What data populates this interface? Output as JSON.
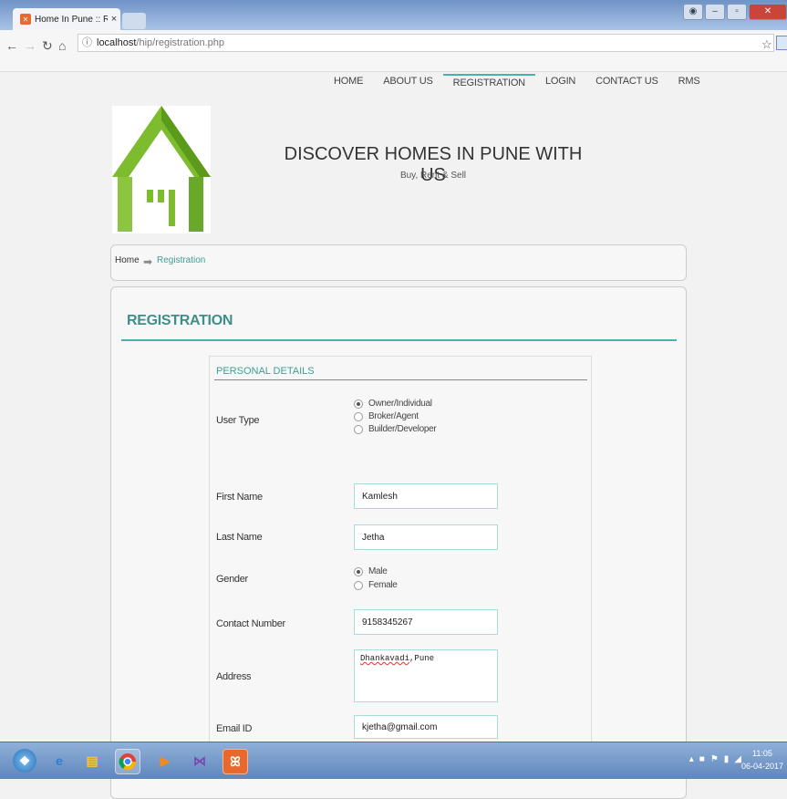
{
  "browser": {
    "tab_title": "Home In Pune :: Registra",
    "url_host": "localhost",
    "url_path": "/hip/registration.php"
  },
  "nav": {
    "items": [
      {
        "label": "HOME",
        "active": false
      },
      {
        "label": "ABOUT US",
        "active": false
      },
      {
        "label": "REGISTRATION",
        "active": true
      },
      {
        "label": "LOGIN",
        "active": false
      },
      {
        "label": "CONTACT US",
        "active": false
      },
      {
        "label": "RMS",
        "active": false
      }
    ]
  },
  "header": {
    "headline": "DISCOVER HOMES IN PUNE WITH US",
    "tagline": "Buy, Rent & Sell"
  },
  "breadcrumb": {
    "home": "Home",
    "current": "Registration"
  },
  "form": {
    "title": "REGISTRATION",
    "section": "PERSONAL DETAILS",
    "user_type_label": "User Type",
    "user_types": [
      "Owner/Individual",
      "Broker/Agent",
      "Builder/Developer"
    ],
    "user_type_selected": "Owner/Individual",
    "first_name_label": "First Name",
    "first_name": "Kamlesh",
    "last_name_label": "Last Name",
    "last_name": "Jetha",
    "gender_label": "Gender",
    "genders": [
      "Male",
      "Female"
    ],
    "gender_selected": "Male",
    "contact_label": "Contact Number",
    "contact": "9158345267",
    "address_label": "Address",
    "address_word": "Dhankavadi",
    "address_rest": ",Pune",
    "email_label": "Email ID",
    "email": "kjetha@gmail.com"
  },
  "taskbar": {
    "time": "11:05",
    "date": "06-04-2017"
  },
  "colors": {
    "accent": "#45b3a7",
    "logo_green": "#7dbb2f"
  }
}
